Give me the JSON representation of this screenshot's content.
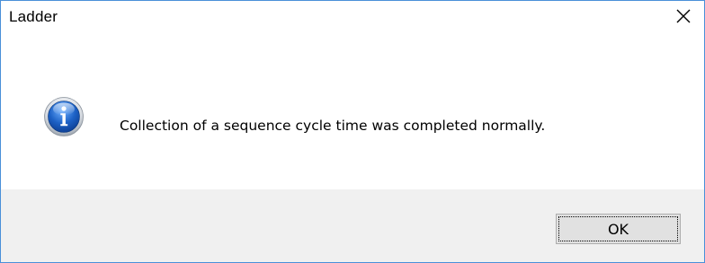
{
  "window": {
    "title": "Ladder",
    "close_icon": "close-icon"
  },
  "message": {
    "icon": "info-icon",
    "text": "Collection of a sequence cycle time was completed normally."
  },
  "buttons": {
    "ok_label": "OK"
  },
  "colors": {
    "window_border": "#4a90d9",
    "footer_background": "#f0f0f0",
    "button_face": "#e1e1e1",
    "icon_blue": "#1d62c6"
  }
}
